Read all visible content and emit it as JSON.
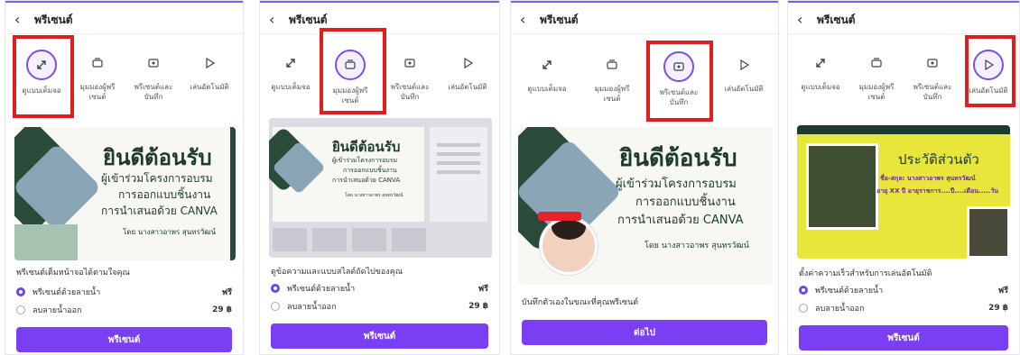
{
  "header_title": "พรีเซนต์",
  "options": [
    {
      "label_1": "ดูแบบเต็มจอ",
      "label_2": "",
      "icon": "expand-icon"
    },
    {
      "label_1": "มุมมองผู้พรี",
      "label_2": "เซนต์",
      "icon": "presenter-view-icon"
    },
    {
      "label_1": "พรีเซนต์และ",
      "label_2": "บันทึก",
      "icon": "record-icon"
    },
    {
      "label_1": "เล่นอัตโนมัติ",
      "label_2": "",
      "icon": "play-icon"
    }
  ],
  "slide1": {
    "title": "ยินดีต้อนรับ",
    "line1": "ผู้เข้าร่วมโครงการอบรม",
    "line2": "การออกแบบชิ้นงาน",
    "line3": "การนำเสนอด้วย CANVA",
    "by": "โดย นางสาวอาพร สุนทรวัฒน์"
  },
  "slide4": {
    "title": "ประวัติส่วนตัว",
    "line1": "ชื่อ-สกุล: นางสาวอาพร สุนทรวัฒน์",
    "line2": "อายุ XX ปี อายุราชการ....ปี....เดือน.....วัน"
  },
  "panels": [
    {
      "caption": "พรีเซนต์เต็มหน้าจอได้ตามใจคุณ",
      "watermark": "พรีเซนต์ด้วยลายน้ำ",
      "watermark_price": "ฟรี",
      "no_watermark": "ลบลายน้ำออก",
      "no_watermark_price": "29 ฿",
      "cta": "พรีเซนต์"
    },
    {
      "caption": "ดูข้อความและแบบสไลด์ถัดไปของคุณ",
      "watermark": "พรีเซนต์ด้วยลายน้ำ",
      "watermark_price": "ฟรี",
      "no_watermark": "ลบลายน้ำออก",
      "no_watermark_price": "29 ฿",
      "cta": "พรีเซนต์"
    },
    {
      "caption": "บันทึกตัวเองในขณะที่คุณพรีเซนต์",
      "cta": "ต่อไป"
    },
    {
      "caption": "ตั้งค่าความเร็วสำหรับการเล่นอัตโนมัติ",
      "watermark": "พรีเซนต์ด้วยลายน้ำ",
      "watermark_price": "ฟรี",
      "no_watermark": "ลบลายน้ำออก",
      "no_watermark_price": "29 ฿",
      "cta": "พรีเซนต์"
    }
  ],
  "colors": {
    "accent": "#7a3ff2",
    "highlight": "#e11e1e",
    "slide_green": "#1e3a2c",
    "slide4_bg": "#e8e63a"
  }
}
